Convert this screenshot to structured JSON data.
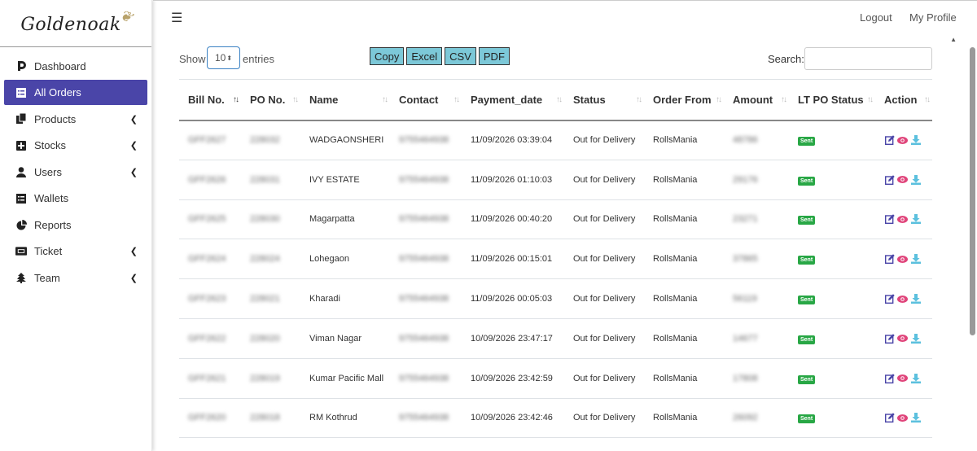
{
  "brand": {
    "logo_text": "Goldenoak"
  },
  "sidebar": {
    "items": [
      {
        "label": "Dashboard",
        "icon": "dashboard-icon",
        "active": false,
        "has_submenu": false
      },
      {
        "label": "All Orders",
        "icon": "orders-icon",
        "active": true,
        "has_submenu": false
      },
      {
        "label": "Products",
        "icon": "products-icon",
        "active": false,
        "has_submenu": true
      },
      {
        "label": "Stocks",
        "icon": "stocks-icon",
        "active": false,
        "has_submenu": true
      },
      {
        "label": "Users",
        "icon": "user-icon",
        "active": false,
        "has_submenu": true
      },
      {
        "label": "Wallets",
        "icon": "wallet-icon",
        "active": false,
        "has_submenu": false
      },
      {
        "label": "Reports",
        "icon": "pie-chart-icon",
        "active": false,
        "has_submenu": false
      },
      {
        "label": "Ticket",
        "icon": "ticket-icon",
        "active": false,
        "has_submenu": true
      },
      {
        "label": "Team",
        "icon": "tree-icon",
        "active": false,
        "has_submenu": true
      }
    ]
  },
  "topbar": {
    "logout": "Logout",
    "profile": "My Profile"
  },
  "controls": {
    "show_label": "Show",
    "entries_value": "10",
    "entries_label": "entries",
    "buttons": [
      "Copy",
      "Excel",
      "CSV",
      "PDF"
    ],
    "search_label": "Search:",
    "search_value": ""
  },
  "table": {
    "columns": [
      "Bill No.",
      "PO No.",
      "Name",
      "Contact",
      "Payment_date",
      "Status",
      "Order From",
      "Amount",
      "LT PO Status",
      "Action"
    ],
    "rows": [
      {
        "bill": "GFF2627",
        "po": "228032",
        "name": "WADGAONSHERI",
        "contact": "9755464938",
        "date": "11/09/2026 03:39:04",
        "status": "Out for Delivery",
        "from": "RollsMania",
        "amount": "48786",
        "lt": "Sent"
      },
      {
        "bill": "GFF2626",
        "po": "228031",
        "name": "IVY ESTATE",
        "contact": "9755464938",
        "date": "11/09/2026 01:10:03",
        "status": "Out for Delivery",
        "from": "RollsMania",
        "amount": "29176",
        "lt": "Sent"
      },
      {
        "bill": "GFF2625",
        "po": "228030",
        "name": "Magarpatta",
        "contact": "9755464938",
        "date": "11/09/2026 00:40:20",
        "status": "Out for Delivery",
        "from": "RollsMania",
        "amount": "23271",
        "lt": "Sent"
      },
      {
        "bill": "GFF2624",
        "po": "228024",
        "name": "Lohegaon",
        "contact": "9755464938",
        "date": "11/09/2026 00:15:01",
        "status": "Out for Delivery",
        "from": "RollsMania",
        "amount": "37865",
        "lt": "Sent"
      },
      {
        "bill": "GFF2623",
        "po": "228021",
        "name": "Kharadi",
        "contact": "9755464938",
        "date": "11/09/2026 00:05:03",
        "status": "Out for Delivery",
        "from": "RollsMania",
        "amount": "56119",
        "lt": "Sent"
      },
      {
        "bill": "GFF2622",
        "po": "228020",
        "name": "Viman Nagar",
        "contact": "9755464938",
        "date": "10/09/2026 23:47:17",
        "status": "Out for Delivery",
        "from": "RollsMania",
        "amount": "14677",
        "lt": "Sent"
      },
      {
        "bill": "GFF2621",
        "po": "228019",
        "name": "Kumar Pacific Mall",
        "contact": "9755464938",
        "date": "10/09/2026 23:42:59",
        "status": "Out for Delivery",
        "from": "RollsMania",
        "amount": "17808",
        "lt": "Sent"
      },
      {
        "bill": "GFF2620",
        "po": "228018",
        "name": "RM Kothrud",
        "contact": "9755464938",
        "date": "10/09/2026 23:42:46",
        "status": "Out for Delivery",
        "from": "RollsMania",
        "amount": "26092",
        "lt": "Sent"
      }
    ]
  },
  "colors": {
    "accent": "#4a45a8",
    "button": "#7cc8d8",
    "badge": "#28a745",
    "edit": "#4a45a8",
    "view": "#e0457b",
    "download": "#5bc0de"
  }
}
